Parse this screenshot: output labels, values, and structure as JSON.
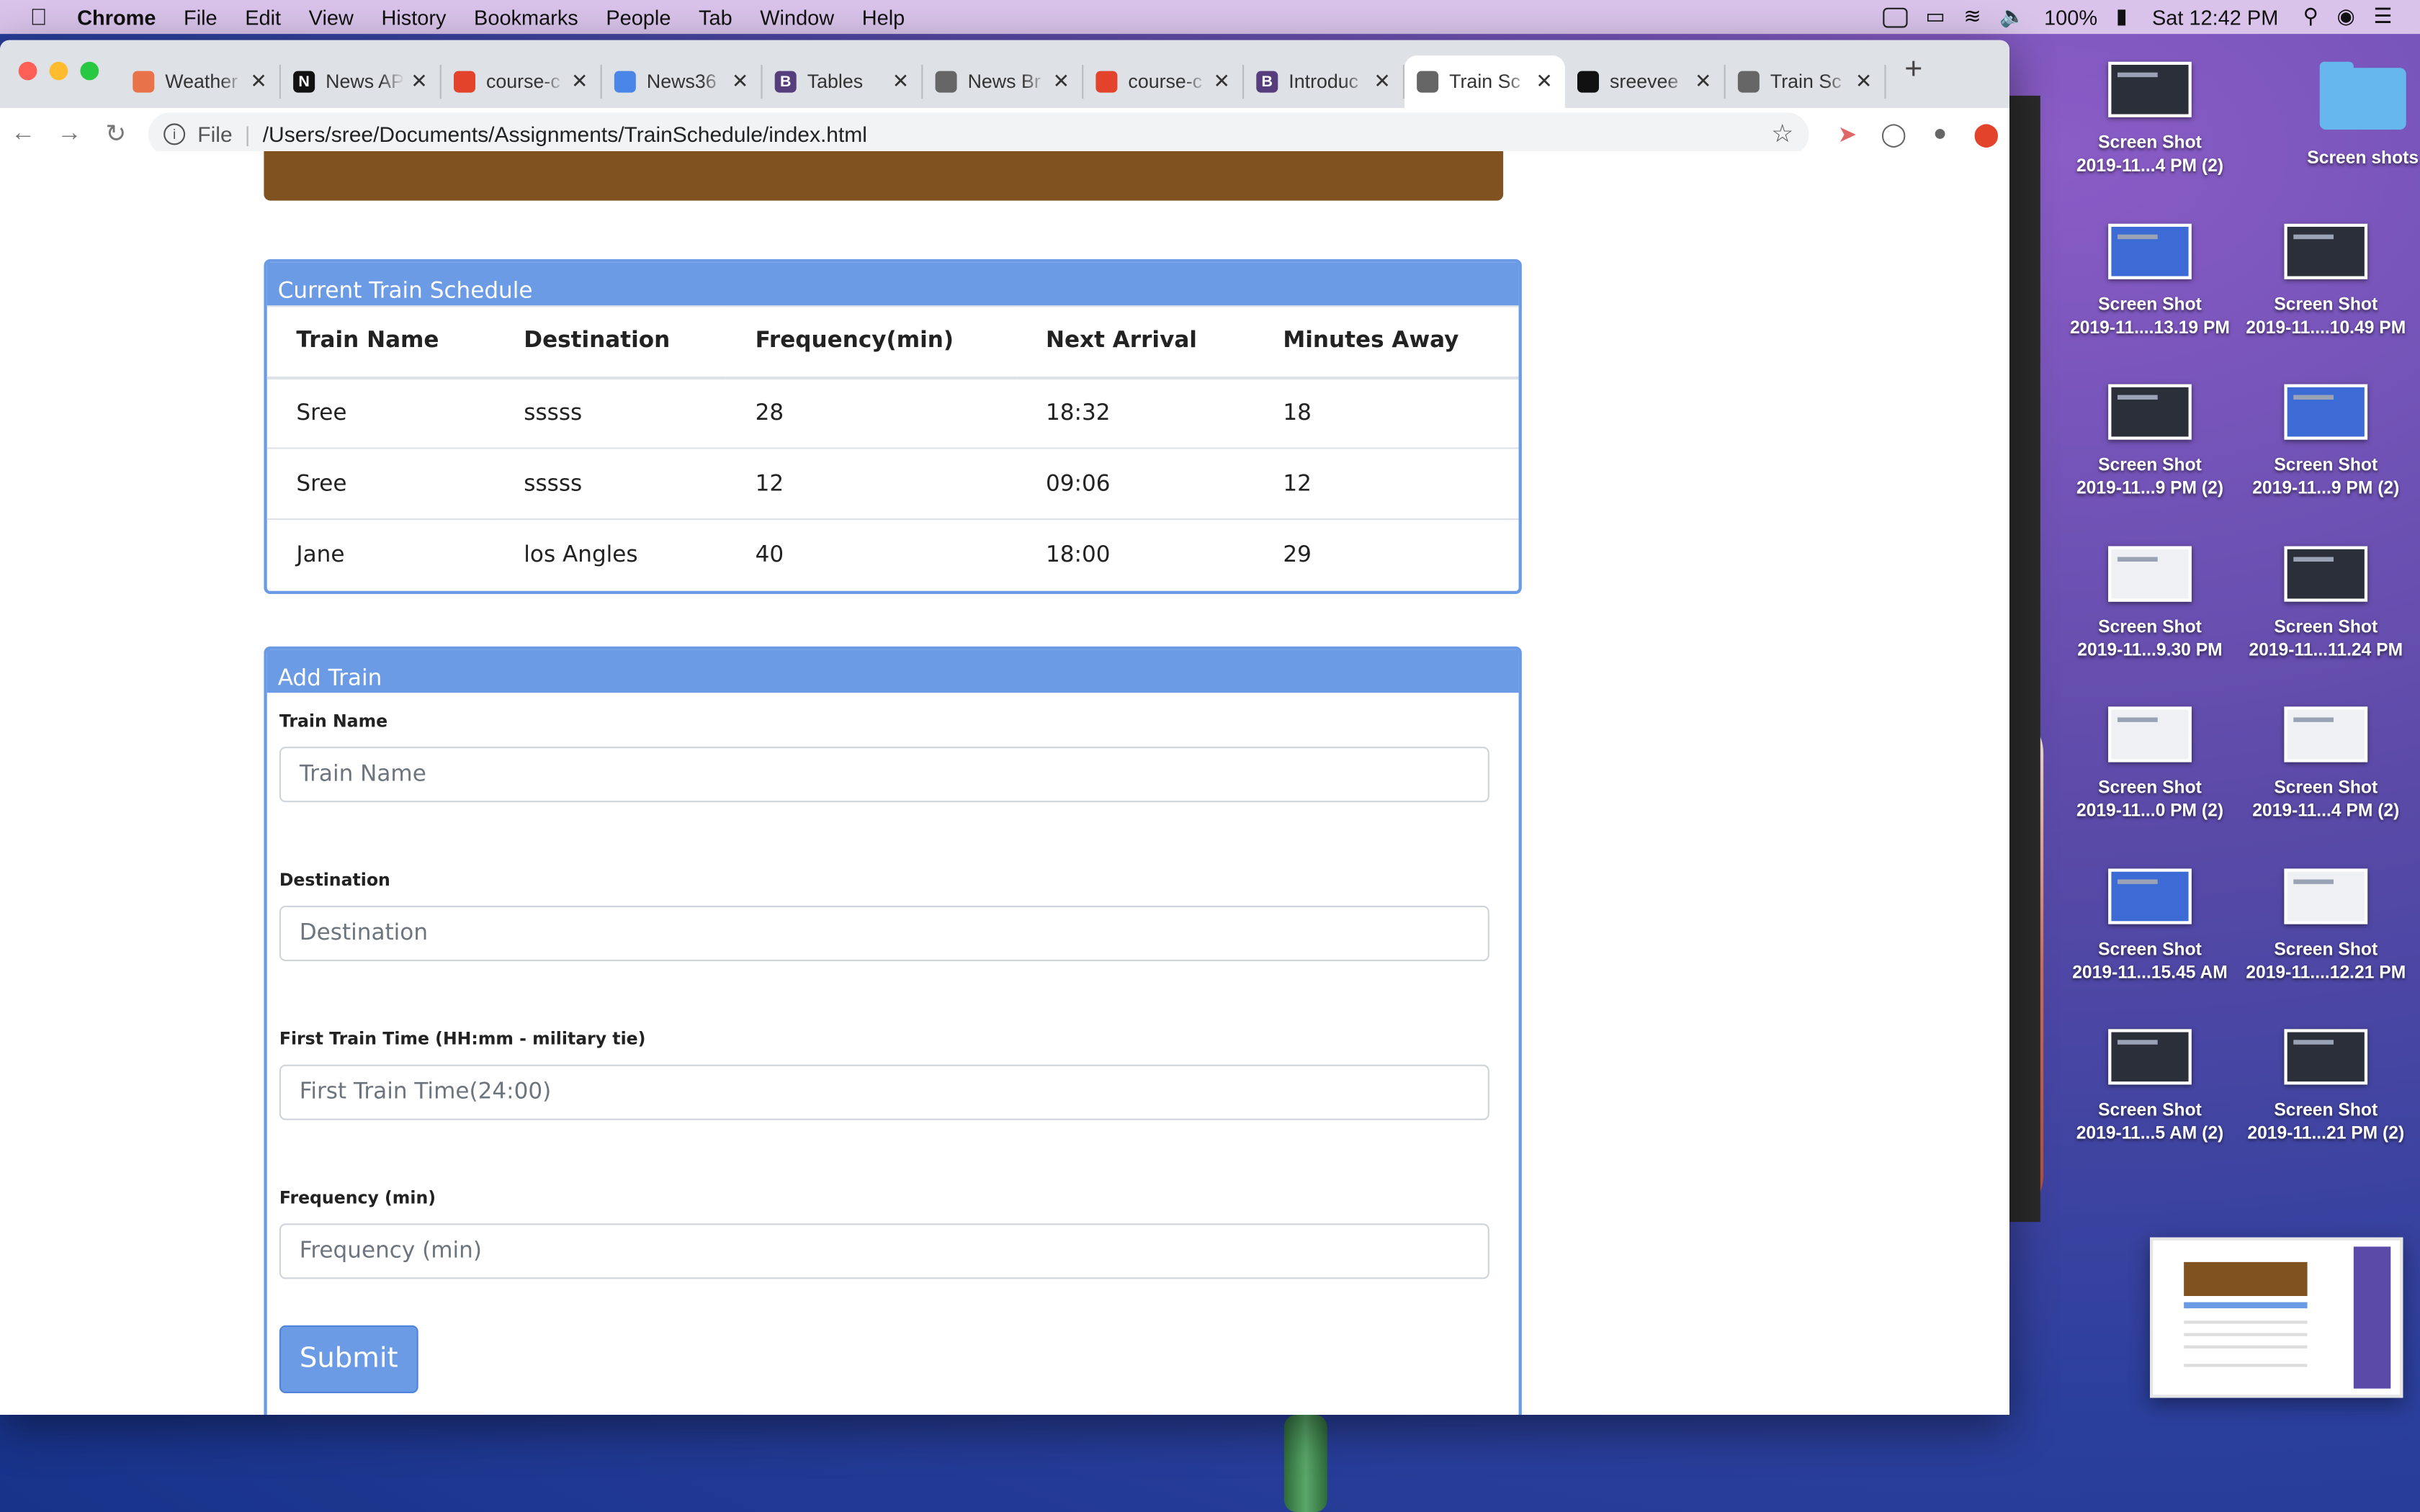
{
  "menubar": {
    "app": "Chrome",
    "items": [
      "File",
      "Edit",
      "View",
      "History",
      "Bookmarks",
      "People",
      "Tab",
      "Window",
      "Help"
    ],
    "battery": "100%",
    "clock": "Sat 12:42 PM"
  },
  "browser": {
    "tabs": [
      {
        "title": "Weather",
        "favicon": "weather-icon",
        "color": "#e8734a",
        "glyph": ""
      },
      {
        "title": "News AP",
        "favicon": "n-logo-icon",
        "color": "#111111",
        "glyph": "N"
      },
      {
        "title": "course-c",
        "favicon": "gitlab-icon",
        "color": "#e2432a",
        "glyph": ""
      },
      {
        "title": "News36",
        "favicon": "chrome-icon",
        "color": "#4a86e8",
        "glyph": ""
      },
      {
        "title": "Tables",
        "favicon": "bootstrap-icon",
        "color": "#563d7c",
        "glyph": "B"
      },
      {
        "title": "News Br",
        "favicon": "globe-icon",
        "color": "#666666",
        "glyph": ""
      },
      {
        "title": "course-c",
        "favicon": "gitlab-icon",
        "color": "#e2432a",
        "glyph": ""
      },
      {
        "title": "Introduc",
        "favicon": "bootstrap-icon",
        "color": "#563d7c",
        "glyph": "B"
      },
      {
        "title": "Train Sc",
        "favicon": "globe-icon",
        "color": "#666666",
        "glyph": "",
        "active": true
      },
      {
        "title": "sreevee",
        "favicon": "github-icon",
        "color": "#111111",
        "glyph": ""
      },
      {
        "title": "Train Sc",
        "favicon": "globe-icon",
        "color": "#666666",
        "glyph": ""
      }
    ],
    "omnibox": {
      "scheme": "File",
      "url": "/Users/sree/Documents/Assignments/TrainSchedule/index.html"
    }
  },
  "page": {
    "schedule": {
      "title": "Current Train Schedule",
      "columns": [
        "Train Name",
        "Destination",
        "Frequency(min)",
        "Next Arrival",
        "Minutes Away"
      ],
      "rows": [
        [
          "Sree",
          "sssss",
          "28",
          "18:32",
          "18"
        ],
        [
          "Sree",
          "sssss",
          "12",
          "09:06",
          "12"
        ],
        [
          "Jane",
          "los Angles",
          "40",
          "18:00",
          "29"
        ]
      ]
    },
    "add_train": {
      "title": "Add Train",
      "fields": [
        {
          "label": "Train Name",
          "placeholder": "Train Name",
          "value": ""
        },
        {
          "label": "Destination",
          "placeholder": "Destination",
          "value": ""
        },
        {
          "label": "First Train Time (HH:mm - military tie)",
          "placeholder": "First Train Time(24:00)",
          "value": ""
        },
        {
          "label": "Frequency (min)",
          "placeholder": "Frequency (min)",
          "value": ""
        }
      ],
      "submit_label": "Submit"
    },
    "colors": {
      "panel_header": "#6c9be6",
      "jumbotron": "#7f5220"
    }
  },
  "desktop": {
    "icons": [
      {
        "l1": "Screen Shot",
        "l2": "2019-11...4 PM (2)",
        "kind": "dark"
      },
      {
        "l1": "Screen shots",
        "l2": "",
        "kind": "folder"
      },
      {
        "l1": "Screen Shot",
        "l2": "2019-11....13.19 PM",
        "kind": "blue"
      },
      {
        "l1": "Screen Shot",
        "l2": "2019-11....10.49 PM",
        "kind": "dark"
      },
      {
        "l1": "Screen Shot",
        "l2": "2019-11...9 PM (2)",
        "kind": "dark"
      },
      {
        "l1": "Screen Shot",
        "l2": "2019-11...9 PM (2)",
        "kind": "blue"
      },
      {
        "l1": "Screen Shot",
        "l2": "2019-11...9.30 PM",
        "kind": "light"
      },
      {
        "l1": "Screen Shot",
        "l2": "2019-11...11.24 PM",
        "kind": "dark"
      },
      {
        "l1": "Screen Shot",
        "l2": "2019-11...0 PM (2)",
        "kind": "light"
      },
      {
        "l1": "Screen Shot",
        "l2": "2019-11...4 PM (2)",
        "kind": "light"
      },
      {
        "l1": "Screen Shot",
        "l2": "2019-11...15.45 AM",
        "kind": "blue"
      },
      {
        "l1": "Screen Shot",
        "l2": "2019-11....12.21 PM",
        "kind": "light"
      },
      {
        "l1": "Screen Shot",
        "l2": "2019-11...5 AM (2)",
        "kind": "dark"
      },
      {
        "l1": "Screen Shot",
        "l2": "2019-11...21 PM (2)",
        "kind": "dark"
      }
    ]
  }
}
